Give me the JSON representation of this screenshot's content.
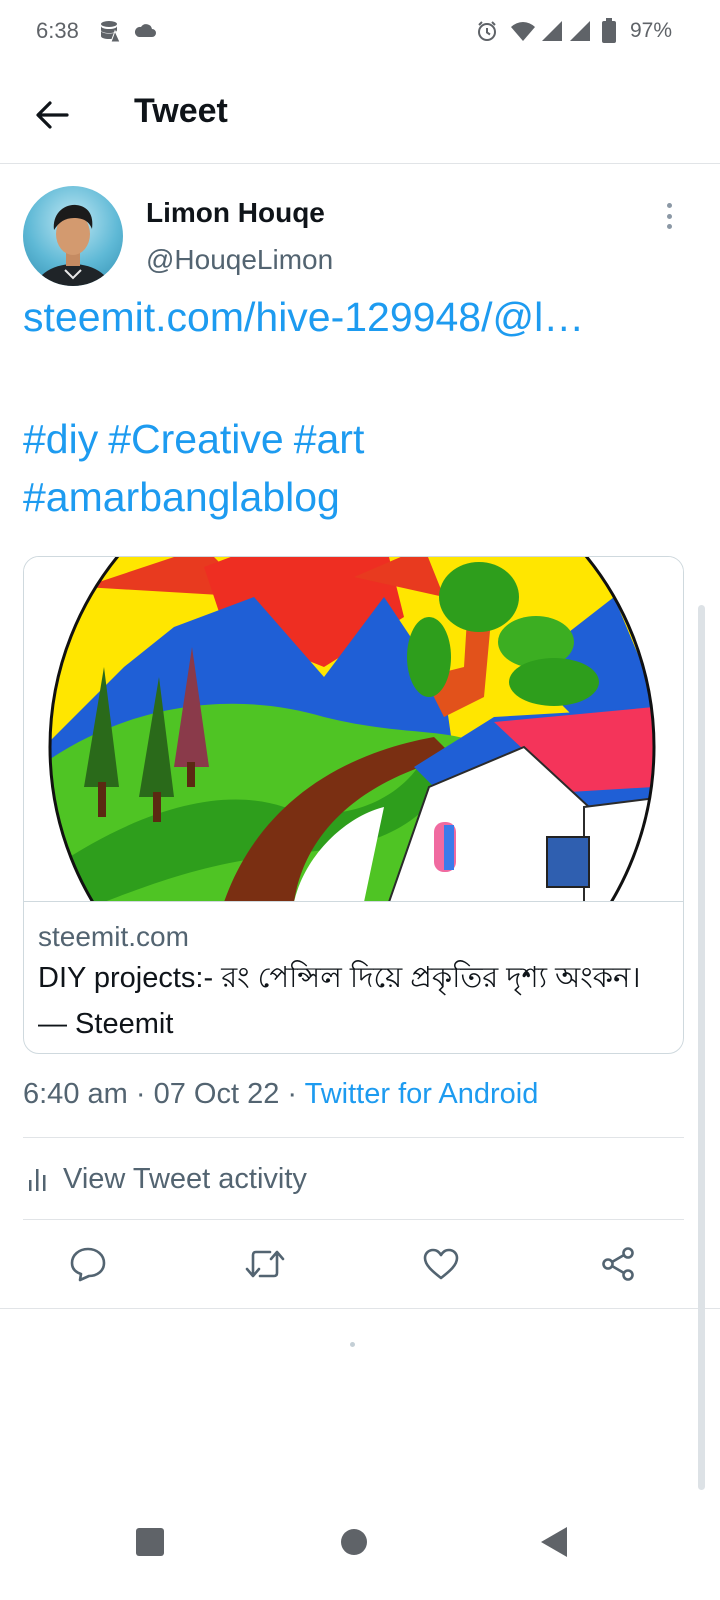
{
  "status_bar": {
    "time": "6:38",
    "battery": "97%",
    "icons": [
      "data-saver-icon",
      "cloud-icon",
      "alarm-icon",
      "wifi-icon",
      "signal-icon",
      "signal-icon",
      "battery-icon"
    ]
  },
  "header": {
    "title": "Tweet",
    "back_icon": "arrow-left-icon"
  },
  "tweet": {
    "author_name": "Limon Houqe",
    "author_handle": "@HouqeLimon",
    "link_text": "steemit.com/hive-129948/@l…",
    "hashtags": [
      "#diy",
      "#Creative",
      "#art",
      "#amarbanglablog"
    ],
    "timestamp": "6:40 am",
    "date": "07 Oct 22",
    "separator": "·",
    "source": "Twitter for Android"
  },
  "link_card": {
    "domain": "steemit.com",
    "title": "DIY projects:- রং পেন্সিল দিয়ে প্রকৃতির দৃশ্য অংকন। — Steemit"
  },
  "activity": {
    "label": "View Tweet activity",
    "icon": "bar-chart-icon"
  },
  "actions": {
    "icons": [
      "reply-icon",
      "retweet-icon",
      "like-icon",
      "share-icon"
    ]
  },
  "nav_bar": {
    "icons": [
      "recents-icon",
      "home-icon",
      "back-icon"
    ]
  },
  "colors": {
    "accent": "#1d9bf0",
    "text_primary": "#0f1419",
    "text_secondary": "#536471",
    "divider": "#e1e4e7"
  }
}
